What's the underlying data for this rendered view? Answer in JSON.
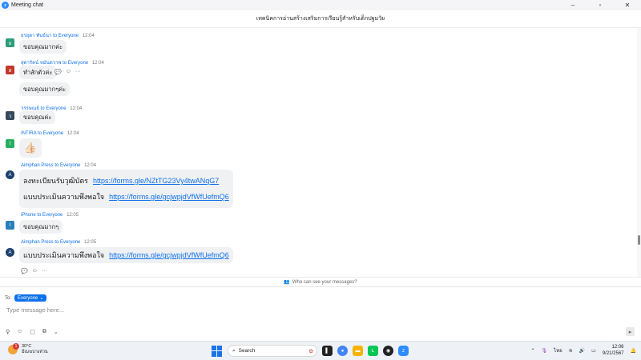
{
  "window": {
    "app_title": "Meeting chat"
  },
  "meeting": {
    "title": "เทคนิคการอ่านสร้างเสริมการเรียนรู้สำหรับเด็กปฐมวัย"
  },
  "messages": [
    {
      "initial": "ย",
      "avatar_color": "#2a9d7a",
      "sender": "ยรยุดา พันธ์นา",
      "to_word": "to",
      "recipient": "Everyone",
      "time": "12:04",
      "bubbles": [
        "ขอบคุณมากค่ะ"
      ]
    },
    {
      "initial": "ส",
      "avatar_color": "#c0392b",
      "sender": "สุดารัตน์ หมันดวาพ",
      "to_word": "to",
      "recipient": "Everyone",
      "time": "12:04",
      "bubbles": [
        "ทำสักตัวค่ะ",
        "ขอบคุณมากๆค่ะ"
      ]
    },
    {
      "initial": "ว",
      "avatar_color": "#34495e",
      "sender": "วรรษณย์",
      "to_word": "to",
      "recipient": "Everyone",
      "time": "12:04",
      "bubbles": [
        "ขอบคุณค่ะ"
      ]
    },
    {
      "initial": "I",
      "avatar_color": "#27ae60",
      "sender": "INTIRA",
      "to_word": "to",
      "recipient": "Everyone",
      "time": "12:04",
      "bubbles": [
        "👍🏻"
      ]
    },
    {
      "initial": "A",
      "avatar_color": "#1c3f6e",
      "sender": "Aimphan Press",
      "to_word": "to",
      "recipient": "Everyone",
      "time": "12:04",
      "lines": [
        {
          "text": "ลงทะเบียนรับวุฒิบัตร",
          "link": "https://forms.gle/NZtTG23Vy4twANqG7"
        },
        {
          "text": "แบบประเมินความพึงพอใจ",
          "link": "https://forms.gle/gcjwpjdVfWfUefmQ6"
        }
      ]
    },
    {
      "initial": "I",
      "avatar_color": "#2980b9",
      "sender": "iPhone",
      "to_word": "to",
      "recipient": "Everyone",
      "time": "12:05",
      "bubbles": [
        "ขอบคุณมากๆ"
      ]
    },
    {
      "initial": "A",
      "avatar_color": "#1c3f6e",
      "sender": "Aimphan Press",
      "to_word": "to",
      "recipient": "Everyone",
      "time": "12:05",
      "lines": [
        {
          "text": "แบบประเมินความพึงพอใจ",
          "link": "https://forms.gle/gcjwpjdVfWfUefmQ6"
        }
      ]
    }
  ],
  "who_can_see": "Who can see your messages?",
  "compose": {
    "to_label": "To:",
    "to_value": "Everyone",
    "placeholder": "Type message here..."
  },
  "taskbar": {
    "weather_temp": "30°C",
    "weather_desc": "มีเมฆบางส่วน",
    "weather_badge": "1",
    "search_label": "Search",
    "lang": "ไทย",
    "time": "12:06",
    "date": "9/21/2567"
  },
  "colors": {
    "accent": "#0e71eb"
  }
}
